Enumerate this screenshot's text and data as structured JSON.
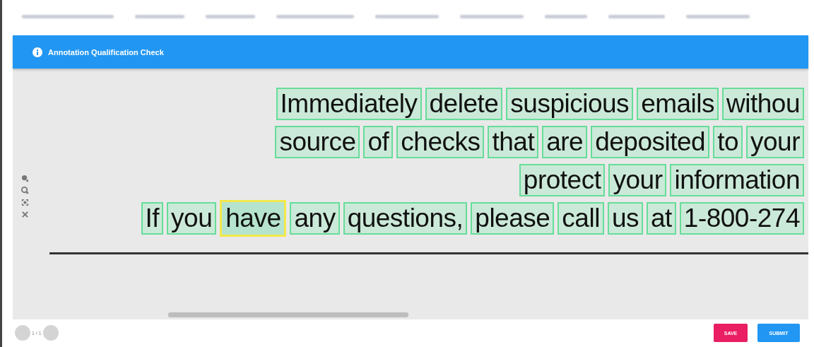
{
  "header": {
    "title": "Annotation Qualification Check"
  },
  "document": {
    "lines": [
      {
        "words": [
          {
            "text": "Immediately",
            "selected": false
          },
          {
            "text": "delete",
            "selected": false
          },
          {
            "text": "suspicious",
            "selected": false
          },
          {
            "text": "emails",
            "selected": false
          },
          {
            "text": "withou",
            "selected": false
          }
        ]
      },
      {
        "words": [
          {
            "text": "source",
            "selected": false
          },
          {
            "text": "of",
            "selected": false
          },
          {
            "text": "checks",
            "selected": false
          },
          {
            "text": "that",
            "selected": false
          },
          {
            "text": "are",
            "selected": false
          },
          {
            "text": "deposited",
            "selected": false
          },
          {
            "text": "to",
            "selected": false
          },
          {
            "text": "your",
            "selected": false
          }
        ]
      },
      {
        "words": [
          {
            "text": "protect",
            "selected": false
          },
          {
            "text": "your",
            "selected": false
          },
          {
            "text": "information",
            "selected": false
          }
        ]
      },
      {
        "words": [
          {
            "text": "If",
            "selected": false
          },
          {
            "text": "you",
            "selected": false
          },
          {
            "text": "have",
            "selected": true
          },
          {
            "text": "any",
            "selected": false
          },
          {
            "text": "questions,",
            "selected": false
          },
          {
            "text": "please",
            "selected": false
          },
          {
            "text": "call",
            "selected": false
          },
          {
            "text": "us",
            "selected": false
          },
          {
            "text": "at",
            "selected": false
          },
          {
            "text": "1-800-274",
            "selected": false
          }
        ]
      }
    ]
  },
  "pager": {
    "text": "1 / 1"
  },
  "buttons": [
    {
      "label": "SAVE",
      "kind": "save"
    },
    {
      "label": "SUBMIT",
      "kind": "submit"
    }
  ]
}
